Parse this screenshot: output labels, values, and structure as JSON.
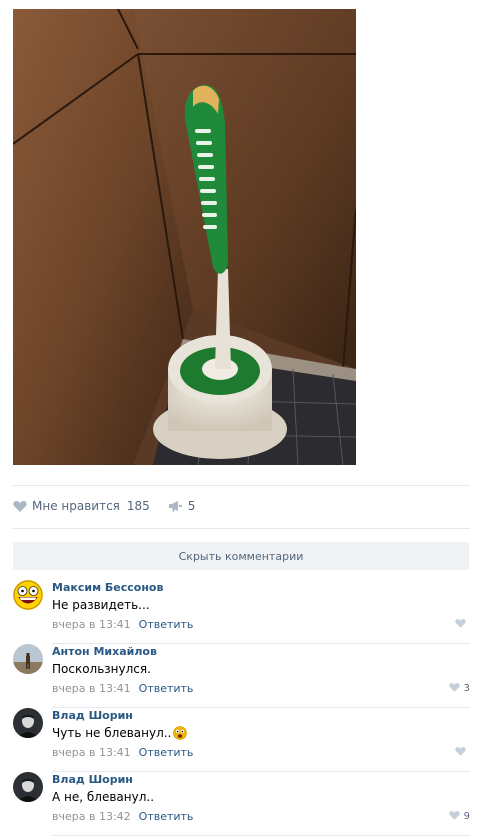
{
  "post": {
    "photo_alt": "toilet brush photo",
    "likes_label": "Мне нравится",
    "likes_count": "185",
    "shares_count": "5"
  },
  "comments_toggle": {
    "label": "Скрыть комментарии"
  },
  "reply_label": "Ответить",
  "comments": [
    {
      "author": "Максим Бессонов",
      "text": "Не развидеть...",
      "time": "вчера в 13:41",
      "likes": ""
    },
    {
      "author": "Антон Михайлов",
      "text": "Поскользнулся.",
      "time": "вчера в 13:41",
      "likes": "3"
    },
    {
      "author": "Влад Шорин",
      "text": "Чуть не блеванул..",
      "time": "вчера в 13:41",
      "likes": ""
    },
    {
      "author": "Влад Шорин",
      "text": "А не, блеванул..",
      "time": "вчера в 13:42",
      "likes": "9"
    }
  ],
  "colors": {
    "link": "#2a5885",
    "muted": "#939393",
    "action": "#55677d",
    "divider": "#e7e8ec",
    "panel": "#f0f2f5"
  },
  "icons": {
    "like": "heart-icon",
    "share": "megaphone-icon",
    "emoji": "scared-face-icon"
  }
}
